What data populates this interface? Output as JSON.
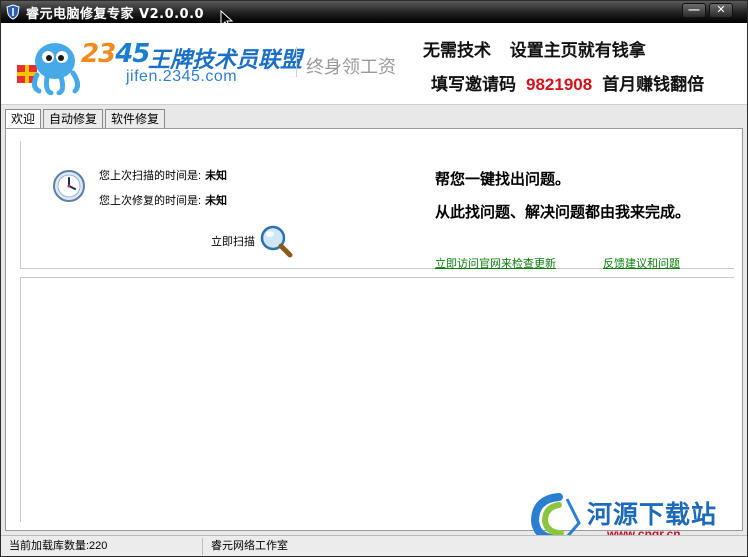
{
  "window": {
    "title": "睿元电脑修复专家 V2.0.0.0",
    "min_label": "—",
    "close_label": "✕"
  },
  "banner": {
    "logo_digits_a": "23",
    "logo_digits_b": "45",
    "logo_text": "王牌技术员联盟",
    "logo_url": "jifen.2345.com",
    "slogan": "终身领工资",
    "ad_line1": "无需技术  设置主页就有钱拿",
    "ad_line2_a": "填写邀请码",
    "ad_line2_code": "9821908",
    "ad_line2_b": "首月赚钱翻倍"
  },
  "tabs": [
    {
      "label": "欢迎",
      "active": true
    },
    {
      "label": "自动修复",
      "active": false
    },
    {
      "label": "软件修复",
      "active": false
    }
  ],
  "welcome": {
    "last_scan_label": "您上次扫描的时间是:",
    "last_scan_value": "未知",
    "last_repair_label": "您上次修复的时间是:",
    "last_repair_value": "未知",
    "scan_label": "立即扫描",
    "message1": "帮您一键找出问题。",
    "message2": "从此找问题、解决问题都由我来完成。",
    "link_update": "立即访问官网来检查更新",
    "link_feedback": "反馈建议和问题"
  },
  "watermark": {
    "title": "河源下载站",
    "url": "www.cngr.cn"
  },
  "status": {
    "left": "当前加载库数量:220",
    "right": "睿元网络工作室"
  },
  "colors": {
    "accent_link": "#0b7c0b",
    "invite_code": "#d4121a",
    "logo_blue": "#1b7fd1"
  }
}
